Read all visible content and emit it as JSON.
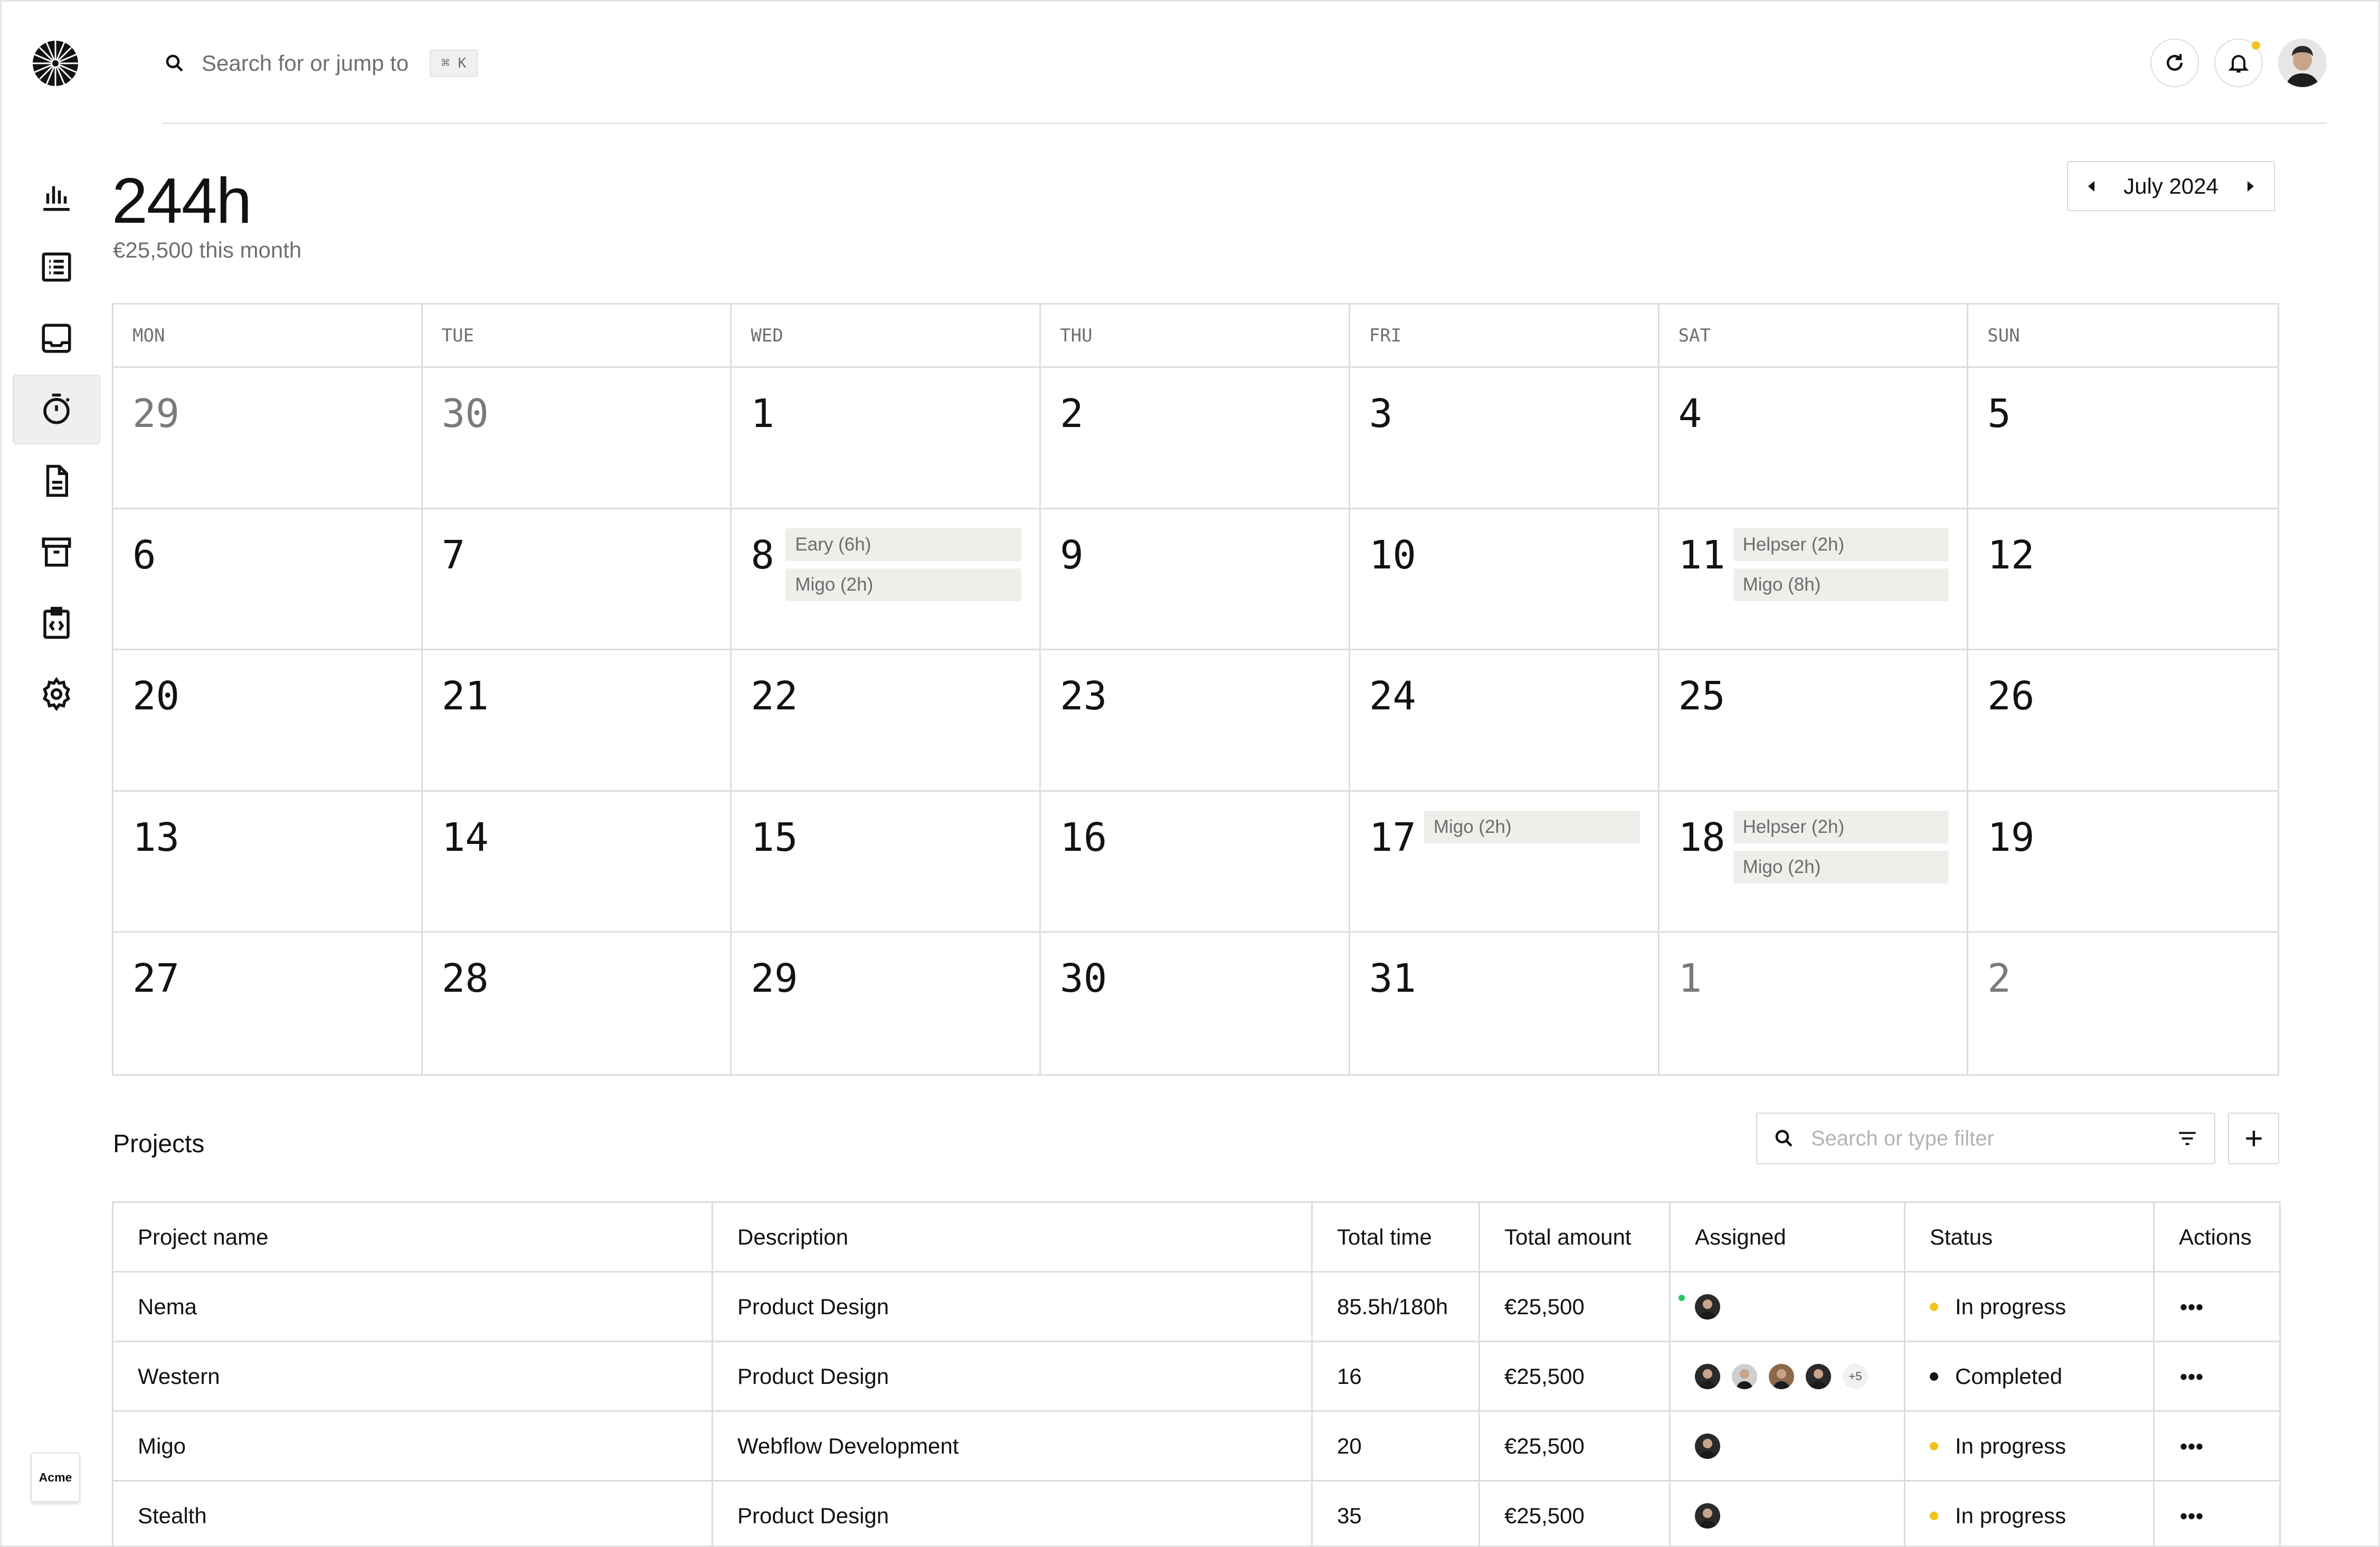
{
  "app": {
    "workspace_label": "Acme"
  },
  "topbar": {
    "search_placeholder": "Search for or jump to",
    "shortcut": "⌘ K"
  },
  "sidebar": {
    "items": [
      {
        "icon": "bar-chart-icon",
        "active": false
      },
      {
        "icon": "list-icon",
        "active": false
      },
      {
        "icon": "inbox-icon",
        "active": false
      },
      {
        "icon": "stopwatch-icon",
        "active": true
      },
      {
        "icon": "document-icon",
        "active": false
      },
      {
        "icon": "archive-icon",
        "active": false
      },
      {
        "icon": "code-clipboard-icon",
        "active": false
      },
      {
        "icon": "gear-icon",
        "active": false
      }
    ]
  },
  "summary": {
    "hours": "244h",
    "earned": "€25,500 this month"
  },
  "month_picker": {
    "label": "July 2024"
  },
  "calendar": {
    "weekdays": [
      "MON",
      "TUE",
      "WED",
      "THU",
      "FRI",
      "SAT",
      "SUN"
    ],
    "weeks": [
      [
        {
          "day": "29",
          "muted": true
        },
        {
          "day": "30",
          "muted": true
        },
        {
          "day": "1"
        },
        {
          "day": "2"
        },
        {
          "day": "3"
        },
        {
          "day": "4"
        },
        {
          "day": "5"
        }
      ],
      [
        {
          "day": "6"
        },
        {
          "day": "7"
        },
        {
          "day": "8",
          "events": [
            "Eary (6h)",
            "Migo (2h)"
          ]
        },
        {
          "day": "9"
        },
        {
          "day": "10"
        },
        {
          "day": "11",
          "events": [
            "Helpser (2h)",
            "Migo (8h)"
          ]
        },
        {
          "day": "12"
        }
      ],
      [
        {
          "day": "20"
        },
        {
          "day": "21"
        },
        {
          "day": "22"
        },
        {
          "day": "23"
        },
        {
          "day": "24"
        },
        {
          "day": "25"
        },
        {
          "day": "26"
        }
      ],
      [
        {
          "day": "13"
        },
        {
          "day": "14"
        },
        {
          "day": "15"
        },
        {
          "day": "16"
        },
        {
          "day": "17",
          "events": [
            "Migo (2h)"
          ]
        },
        {
          "day": "18",
          "events": [
            "Helpser (2h)",
            "Migo (2h)"
          ]
        },
        {
          "day": "19"
        }
      ],
      [
        {
          "day": "27"
        },
        {
          "day": "28"
        },
        {
          "day": "29"
        },
        {
          "day": "30"
        },
        {
          "day": "31"
        },
        {
          "day": "1",
          "muted": true
        },
        {
          "day": "2",
          "muted": true
        }
      ]
    ]
  },
  "projects": {
    "title": "Projects",
    "filter_placeholder": "Search or type filter",
    "columns": [
      "Project name",
      "Description",
      "Total time",
      "Total amount",
      "Assigned",
      "Status",
      "Actions"
    ],
    "rows": [
      {
        "name": "Nema",
        "description": "Product Design",
        "time": "85.5h/180h",
        "amount": "€25,500",
        "assigned": 1,
        "online": true,
        "extra": "",
        "status": "In progress",
        "status_color": "#f2c31a"
      },
      {
        "name": "Western",
        "description": "Product Design",
        "time": "16",
        "amount": "€25,500",
        "assigned": 4,
        "online": false,
        "extra": "+5",
        "status": "Completed",
        "status_color": "#121212"
      },
      {
        "name": "Migo",
        "description": "Webflow Development",
        "time": "20",
        "amount": "€25,500",
        "assigned": 1,
        "online": false,
        "extra": "",
        "status": "In progress",
        "status_color": "#f2c31a"
      },
      {
        "name": "Stealth",
        "description": "Product Design",
        "time": "35",
        "amount": "€25,500",
        "assigned": 1,
        "online": false,
        "extra": "",
        "status": "In progress",
        "status_color": "#f2c31a"
      }
    ]
  }
}
